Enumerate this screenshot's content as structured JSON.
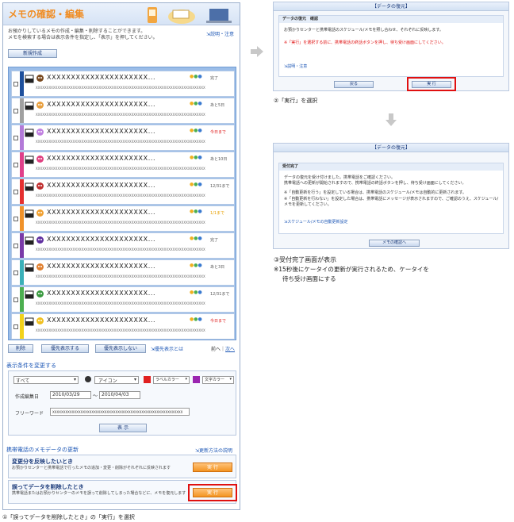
{
  "main": {
    "title": "メモの確認・編集",
    "desc1": "お預かりしているメモの作成・編集・削除することができます。",
    "desc2": "メモを検索する場合は表示条件を指定し、「表示」を押してください。",
    "help_link": "説明・注意",
    "new_button": "新規作成"
  },
  "memos": [
    {
      "title": "XXXXXXXXXXXXXXXXXXXXX...",
      "status": "",
      "date": "完了",
      "date_color": "normal",
      "color": "#1d4f9c",
      "body": "XXXXXXXXXXXXXXXXXXXXXXXXXXXXXXXXXXXXXXXXXXXXXXXXXXXXXXXXXXXXXXXXXXXXXXXXXXXXXX"
    },
    {
      "title": "XXXXXXXXXXXXXXXXXXXXX...",
      "status": "",
      "date": "あと5日",
      "date_color": "normal",
      "color": "#a0a0a0",
      "body": "XXXXXXXXXXXXXXXXXXXXXXXXXXXXXXXXXXXXXXXXXXXXXXXXXXXXXXXXXXXXXXXXXXXXXXXXXXXXXX"
    },
    {
      "title": "XXXXXXXXXXXXXXXXXXXXX...",
      "status": "",
      "date": "今日まで",
      "date_color": "red",
      "color": "#b37ad8",
      "body": "XXXXXXXXXXXXXXXXXXXXXXXXXXXXXXXXXXXXXXXXXXXXXXXXXXXXXXXXXXXXXXXXXXXXXXXXXXXXXX"
    },
    {
      "title": "XXXXXXXXXXXXXXXXXXXXX...",
      "status": "",
      "date": "あと10日",
      "date_color": "normal",
      "color": "#e0408a",
      "body": "XXXXXXXXXXXXXXXXXXXXXXXXXXXXXXXXXXXXXXXXXXXXXXXXXXXXXXXXXXXXXXXXXXXXXXXXXXXXXX"
    },
    {
      "title": "XXXXXXXXXXXXXXXXXXXXX...",
      "status": "",
      "date": "12/31まで",
      "date_color": "normal",
      "color": "#e53030",
      "body": "XXXXXXXXXXXXXXXXXXXXXXXXXXXXXXXXXXXXXXXXXXXXXXXXXXXXXXXXXXXXXXXXXXXXXXXXXXXXXX"
    },
    {
      "title": "XXXXXXXXXXXXXXXXXXXXX...",
      "status": "",
      "date": "1/1まで",
      "date_color": "org",
      "color": "#f0922a",
      "body": "XXXXXXXXXXXXXXXXXXXXXXXXXXXXXXXXXXXXXXXXXXXXXXXXXXXXXXXXXXXXXXXXXXXXXXXXXXXXXX"
    },
    {
      "title": "XXXXXXXXXXXXXXXXXXXXX...",
      "status": "",
      "date": "完了",
      "date_color": "normal",
      "color": "#7a3aa8",
      "body": "XXXXXXXXXXXXXXXXXXXXXXXXXXXXXXXXXXXXXXXXXXXXXXXXXXXXXXXXXXXXXXXXXXXXXXXXXXXXXX"
    },
    {
      "title": "XXXXXXXXXXXXXXXXXXXXX...",
      "status": "",
      "date": "あと3日",
      "date_color": "normal",
      "color": "#3ab0b8",
      "body": "XXXXXXXXXXXXXXXXXXXXXXXXXXXXXXXXXXXXXXXXXXXXXXXXXXXXXXXXXXXXXXXXXXXXXXXXXXXXXX"
    },
    {
      "title": "XXXXXXXXXXXXXXXXXXXXX...",
      "status": "",
      "date": "12/31まで",
      "date_color": "normal",
      "color": "#4caf50",
      "body": "XXXXXXXXXXXXXXXXXXXXXXXXXXXXXXXXXXXXXXXXXXXXXXXXXXXXXXXXXXXXXXXXXXXXXXXXXXXXXX"
    },
    {
      "title": "XXXXXXXXXXXXXXXXXXXXX...",
      "status": "",
      "date": "今日まで",
      "date_color": "red",
      "color": "#f2d21a",
      "body": "XXXXXXXXXXXXXXXXXXXXXXXXXXXXXXXXXXXXXXXXXXXXXXXXXXXXXXXXXXXXXXXXXXXXXXXXXXXXXX"
    }
  ],
  "list_footer": {
    "delete": "削除",
    "priority_show": "優先表示する",
    "priority_hide": "優先表示しない",
    "priority_link": "優先表示とは",
    "pager_prev": "前へ",
    "pager_sep": "｜",
    "pager_next": "次へ"
  },
  "filter": {
    "heading": "表示条件を変更する",
    "category": "すべて",
    "icon_label": "アイコン",
    "label_color": "ラベルカラー",
    "text_color": "文字カラー",
    "date_label": "作成編集日",
    "date_from": "2010/03/29",
    "date_sep": "～",
    "date_to": "2010/04/03",
    "free_label": "フリーワード",
    "free_value": "XXXXXXXXXXXXXXXXXXXXXXXXXXXXXXXXXXXXXXXXXXXXXXXXXXXXXXXXXXXX",
    "show_button": "表 示"
  },
  "update": {
    "heading": "携帯電話のメモデータの更新",
    "method_link": "更新方法の説明",
    "reflect_title": "変更分を反映したいとき",
    "reflect_desc": "お預かりセンターと携帯電話で行ったメモの追加・変更・削除がそれぞれに反映されます",
    "reflect_button": "実 行",
    "restore_title": "誤ってデータを削除したとき",
    "restore_desc": "携帯電話またはお預かりセンターのメモを誤って削除してしまった場合などに、メモを復元します",
    "restore_button": "実 行"
  },
  "caption1": "①「誤ってデータを削除したとき」の「実行」を選択",
  "confirm": {
    "header": "【データの復元】",
    "subtitle": "データの復元　確認",
    "desc": "お預かりセンターと携帯電話のスケジュール/メモを照し合わせ、それぞれに反映します。",
    "warning": "※「実行」を選択する前に、携帯電話の終話ボタンを押し、待ち受け画面にしてください。",
    "help_link": "説明・注意",
    "back_button": "戻る",
    "exec_button": "実 行"
  },
  "caption2": "②「実行」を選択",
  "complete": {
    "header": "【データの復元】",
    "subtitle": "受付完了",
    "line1": "データの復元を受け付けました。携帯電話をご確認ください。",
    "line2": "携帯電話への更新が開始されますので、携帯電話の終話ボタンを押し、待ち受け画面にしてください。",
    "line3": "※「自動更新を行う」を設定している場合は、携帯電話のスケジュール/メモは自動的に更新されます。",
    "line4": "※「自動更新を行わない」を設定した場合は、携帯電話にメッセージが表示されますので、ご確認のうえ、スケジュール/メモを更新してください。",
    "auto_link": "スケジュール/メモの自動更新設定",
    "back_button": "メモの確認へ"
  },
  "caption3": "③受付完了画面が表示",
  "caption4": "※15秒後にケータイの更新が実行されるため、ケータイを",
  "caption5": "待ち受け画面にする",
  "colors": {
    "accent": "#f08c22",
    "highlight": "#e01010",
    "link": "#1a55b5"
  }
}
